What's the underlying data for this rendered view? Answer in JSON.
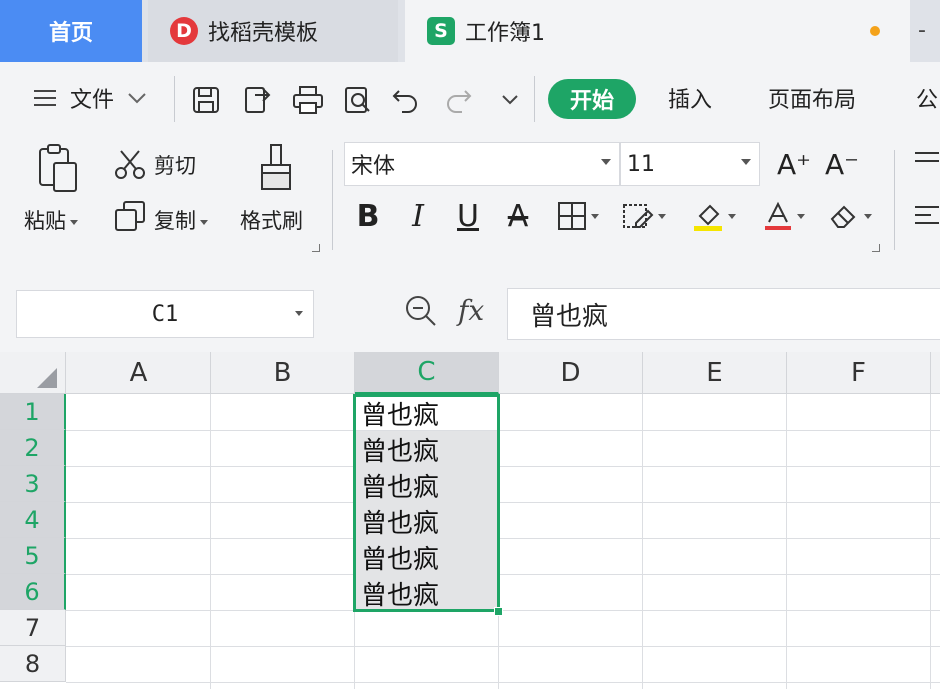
{
  "tabs": {
    "home": "首页",
    "template": "找稻壳模板",
    "template_icon": "D",
    "workbook": "工作簿1",
    "workbook_icon": "S",
    "more": "-"
  },
  "menu": {
    "file": "文件",
    "start": "开始",
    "insert": "插入",
    "page_layout": "页面布局",
    "formulas_partial": "公"
  },
  "ribbon": {
    "paste": "粘贴",
    "cut": "剪切",
    "copy": "复制",
    "format_painter": "格式刷",
    "font_name": "宋体",
    "font_size": "11",
    "increase_font": "A⁺",
    "decrease_font": "A⁻",
    "bold": "B",
    "italic": "I",
    "underline": "U",
    "strikethrough": "A"
  },
  "formula_bar": {
    "name_box": "C1",
    "fx": "fx",
    "value": "曾也疯"
  },
  "sheet": {
    "columns": [
      "A",
      "B",
      "C",
      "D",
      "E",
      "F"
    ],
    "active_column": "C",
    "rows": [
      "1",
      "2",
      "3",
      "4",
      "5",
      "6",
      "7",
      "8"
    ],
    "c_values": [
      "曾也疯",
      "曾也疯",
      "曾也疯",
      "曾也疯",
      "曾也疯",
      "曾也疯"
    ]
  },
  "colors": {
    "accent": "#1ea566",
    "home_tab": "#4b8cf3",
    "template_icon": "#e4393c",
    "unsaved_dot": "#f4a21a"
  }
}
